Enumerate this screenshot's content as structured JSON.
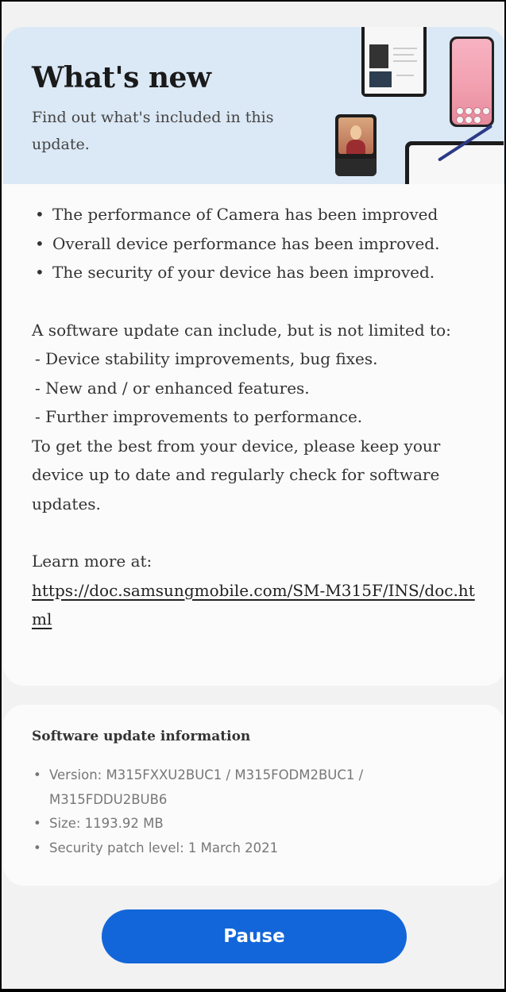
{
  "header": {
    "title": "What's new",
    "subtitle": "Find out what's included in this update."
  },
  "changes": {
    "bullets": [
      "The performance of Camera has been improved",
      "Overall device performance has been improved.",
      "The security of your device has been improved."
    ],
    "intro": "A software update can include, but is not limited to:",
    "items": [
      "- Device stability improvements, bug fixes.",
      "- New and / or enhanced features.",
      "- Further improvements to performance."
    ],
    "advice": "To get the best from your device, please keep your device up to date and regularly check for software updates.",
    "learn_more_label": "Learn more at:",
    "learn_more_url": "https://doc.samsungmobile.com/SM-M315F/INS/doc.html"
  },
  "update_info": {
    "heading": "Software update information",
    "version": "Version: M315FXXU2BUC1 / M315FODM2BUC1 / M315FDDU2BUB6",
    "size": "Size: 1193.92 MB",
    "security_patch": "Security patch level: 1 March 2021"
  },
  "actions": {
    "pause_label": "Pause"
  },
  "colors": {
    "banner_bg": "#dbe8f5",
    "button_bg": "#1266d9",
    "screen_bg": "#f2f2f2"
  }
}
